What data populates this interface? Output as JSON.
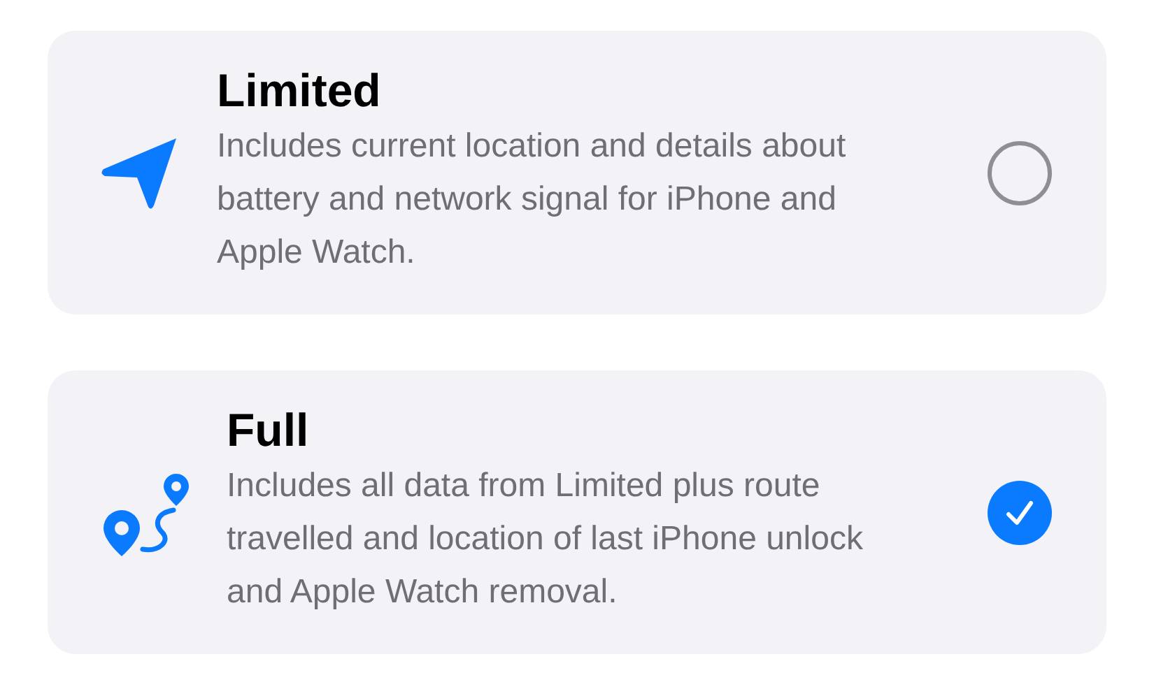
{
  "options": [
    {
      "kind": "arrow",
      "title": "Limited",
      "description": "Includes current location and details about battery and network signal for iPhone and Apple Watch.",
      "selected": false
    },
    {
      "kind": "route",
      "title": "Full",
      "description": "Includes all data from Limited plus route travelled and location of last iPhone unlock and Apple Watch removal.",
      "selected": true
    }
  ]
}
